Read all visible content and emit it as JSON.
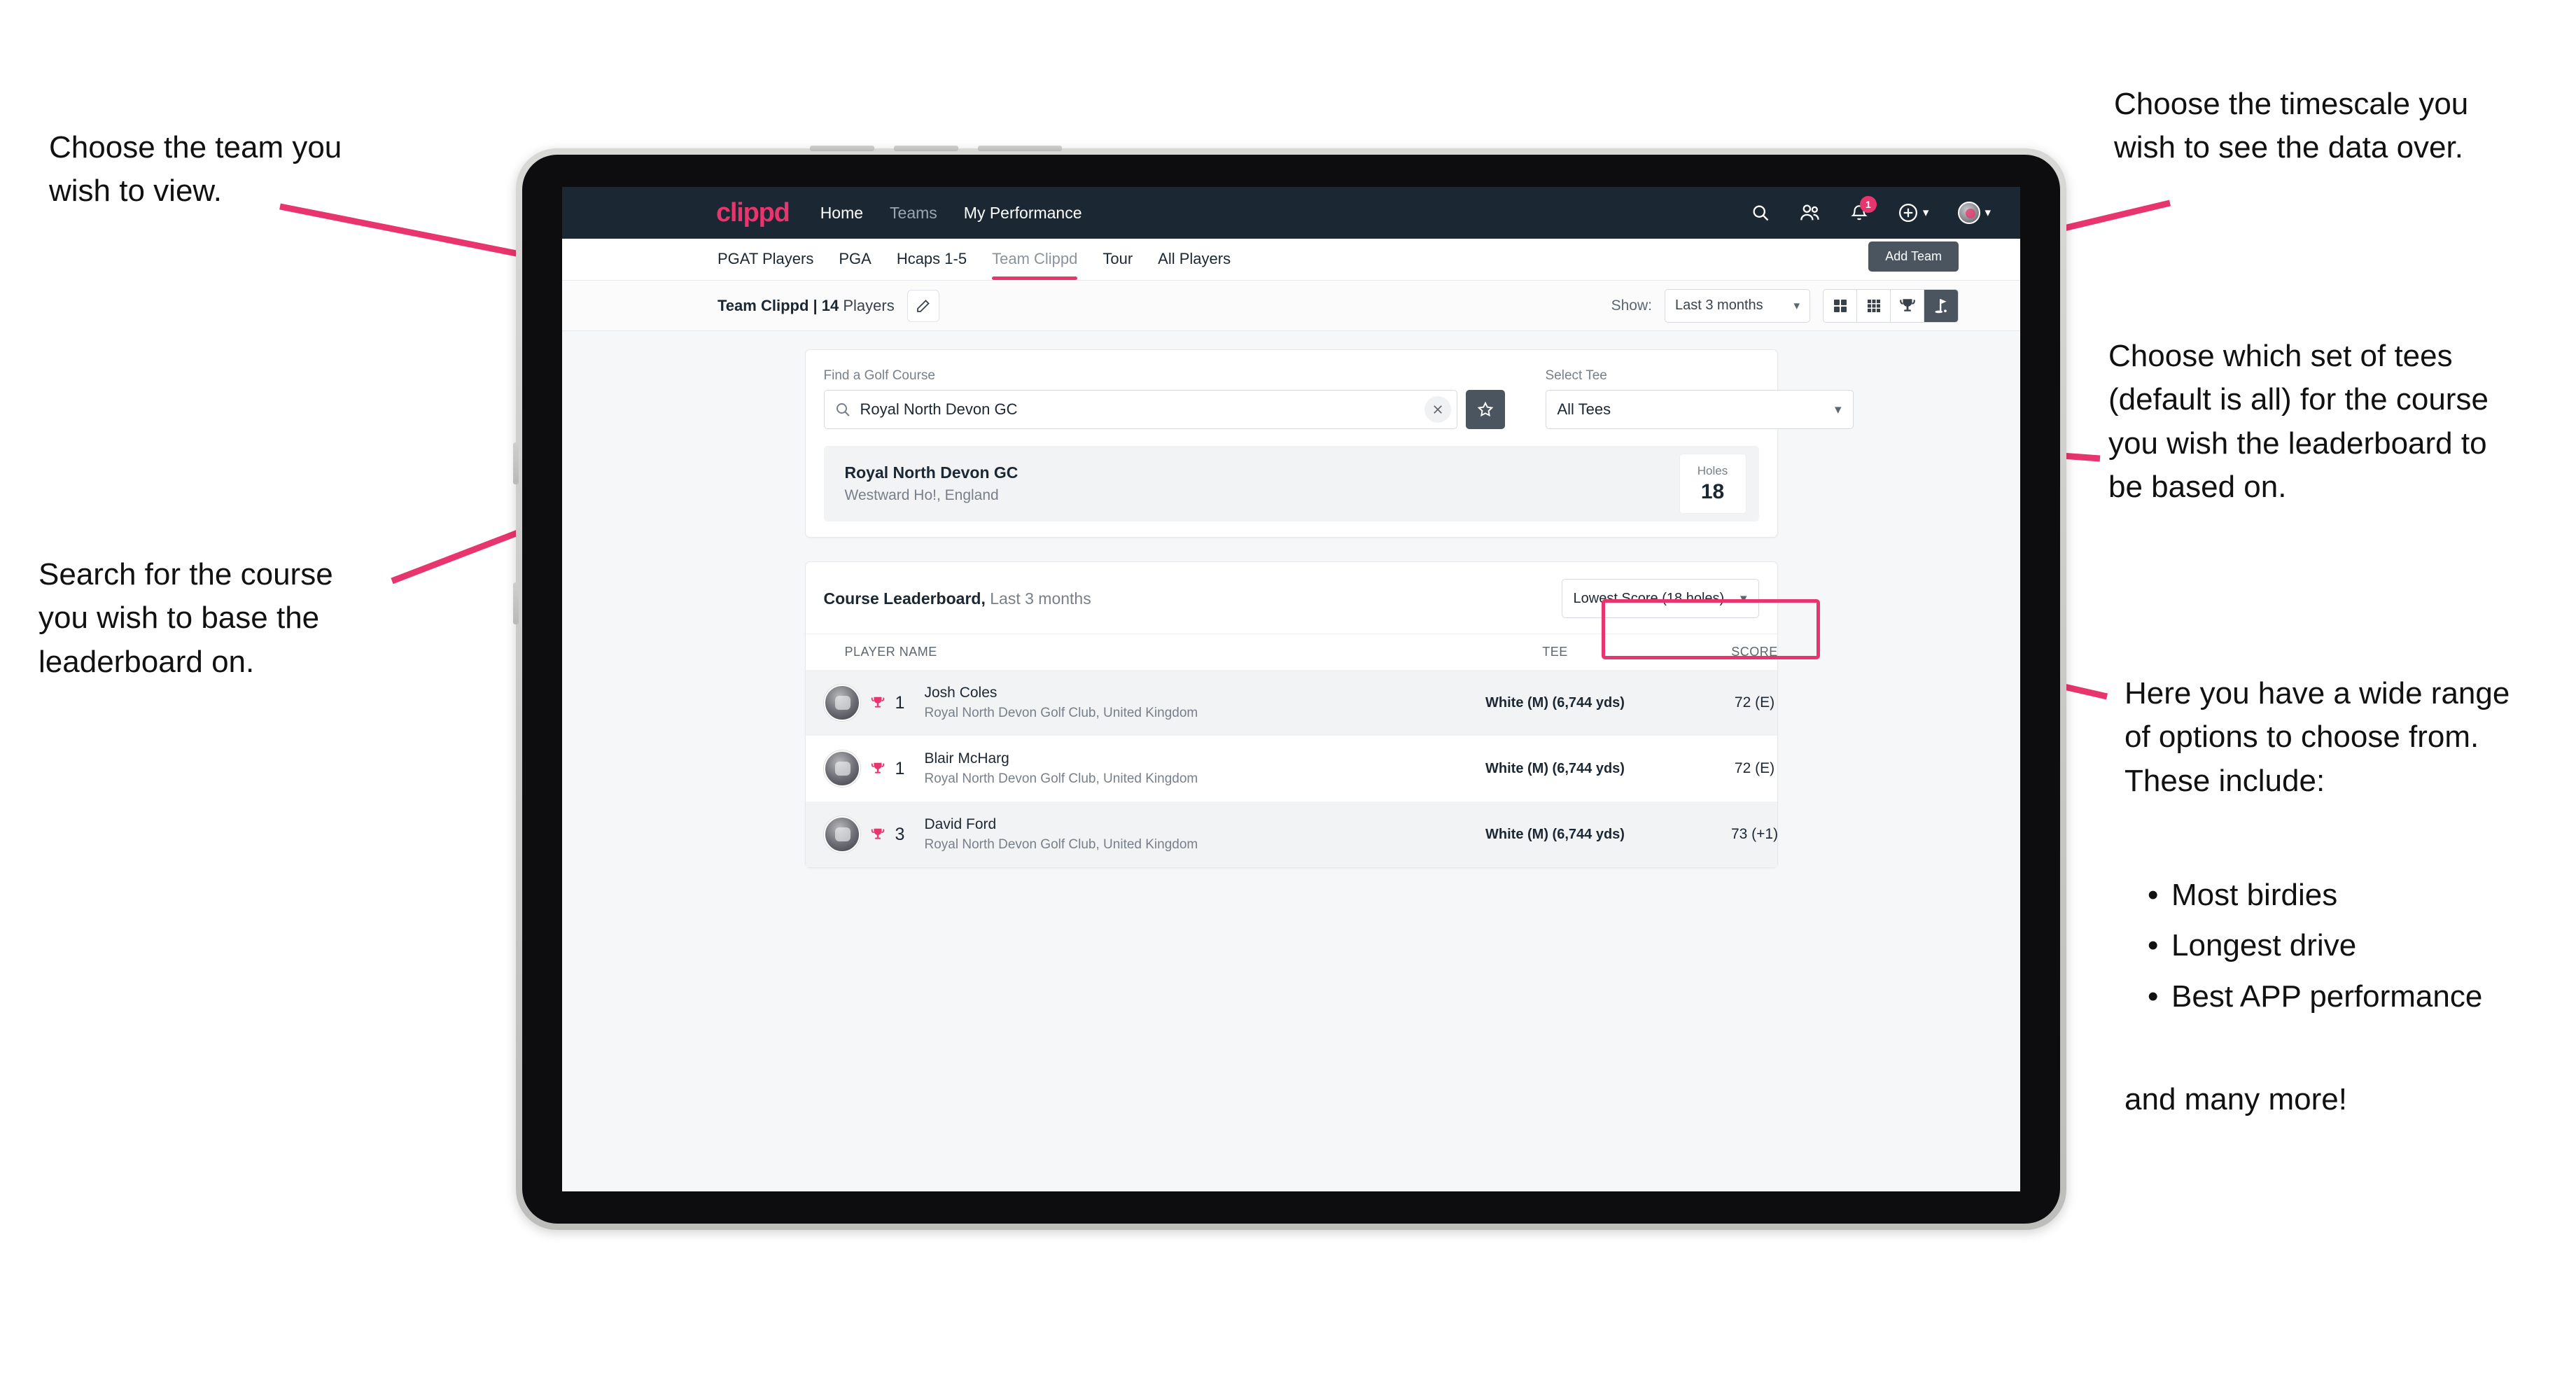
{
  "annotations": {
    "left_top": "Choose the team you\nwish to view.",
    "left_mid": "Search for the course\nyou wish to base the\nleaderboard on.",
    "right_top": "Choose the timescale you\nwish to see the data over.",
    "right_tees": "Choose which set of tees\n(default is all) for the course\nyou wish the leaderboard to\nbe based on.",
    "right_options_intro": "Here you have a wide range\nof options to choose from.\nThese include:",
    "right_options_bullets": [
      "Most birdies",
      "Longest drive",
      "Best APP performance"
    ],
    "right_options_outro": "and many more!",
    "accent_color": "#e8356d"
  },
  "navbar": {
    "brand": "clippd",
    "links": [
      {
        "label": "Home",
        "dim": false
      },
      {
        "label": "Teams",
        "dim": true
      },
      {
        "label": "My Performance",
        "dim": false
      }
    ],
    "icons": [
      {
        "name": "search-icon"
      },
      {
        "name": "people-icon"
      },
      {
        "name": "notifications-icon"
      },
      {
        "name": "add-circle-icon"
      },
      {
        "name": "account-avatar"
      }
    ],
    "notification_count": "1"
  },
  "tabs": {
    "items": [
      {
        "label": "PGAT Players",
        "active": false,
        "muted": false
      },
      {
        "label": "PGA",
        "active": false,
        "muted": false
      },
      {
        "label": "Hcaps 1-5",
        "active": false,
        "muted": false
      },
      {
        "label": "Team Clippd",
        "active": true,
        "muted": true
      },
      {
        "label": "Tour",
        "active": false,
        "muted": false
      },
      {
        "label": "All Players",
        "active": false,
        "muted": false
      }
    ],
    "add_team_label": "Add Team"
  },
  "toolbar": {
    "team_name": "Team Clippd | 14",
    "team_suffix": " Players",
    "edit_icon": "pencil-icon",
    "show_label": "Show:",
    "timescale_value": "Last 3 months",
    "view_buttons": [
      {
        "name": "grid-2x2-view-button",
        "active": false
      },
      {
        "name": "grid-3x3-view-button",
        "active": false
      },
      {
        "name": "trophy-view-button",
        "active": false
      },
      {
        "name": "golf-flag-view-button",
        "active": true
      }
    ]
  },
  "search_card": {
    "course_label": "Find a Golf Course",
    "course_value": "Royal North Devon GC",
    "course_placeholder": "Find a Golf Course",
    "clear_icon": "close-icon",
    "favorite_icon": "star-icon",
    "tee_label": "Select Tee",
    "tee_value": "All Tees"
  },
  "course_result": {
    "name": "Royal North Devon GC",
    "location": "Westward Ho!, England",
    "holes_label": "Holes",
    "holes_value": "18"
  },
  "leaderboard": {
    "title": "Course Leaderboard,",
    "subtitle": " Last 3 months",
    "sort_value": "Lowest Score (18 holes)",
    "columns": [
      "PLAYER NAME",
      "TEE",
      "SCORE"
    ],
    "rows": [
      {
        "rank": "1",
        "name": "Josh Coles",
        "club": "Royal North Devon Golf Club, United Kingdom",
        "tee": "White (M) (6,744 yds)",
        "score": "72 (E)"
      },
      {
        "rank": "1",
        "name": "Blair McHarg",
        "club": "Royal North Devon Golf Club, United Kingdom",
        "tee": "White (M) (6,744 yds)",
        "score": "72 (E)"
      },
      {
        "rank": "3",
        "name": "David Ford",
        "club": "Royal North Devon Golf Club, United Kingdom",
        "tee": "White (M) (6,744 yds)",
        "score": "73 (+1)"
      }
    ]
  }
}
